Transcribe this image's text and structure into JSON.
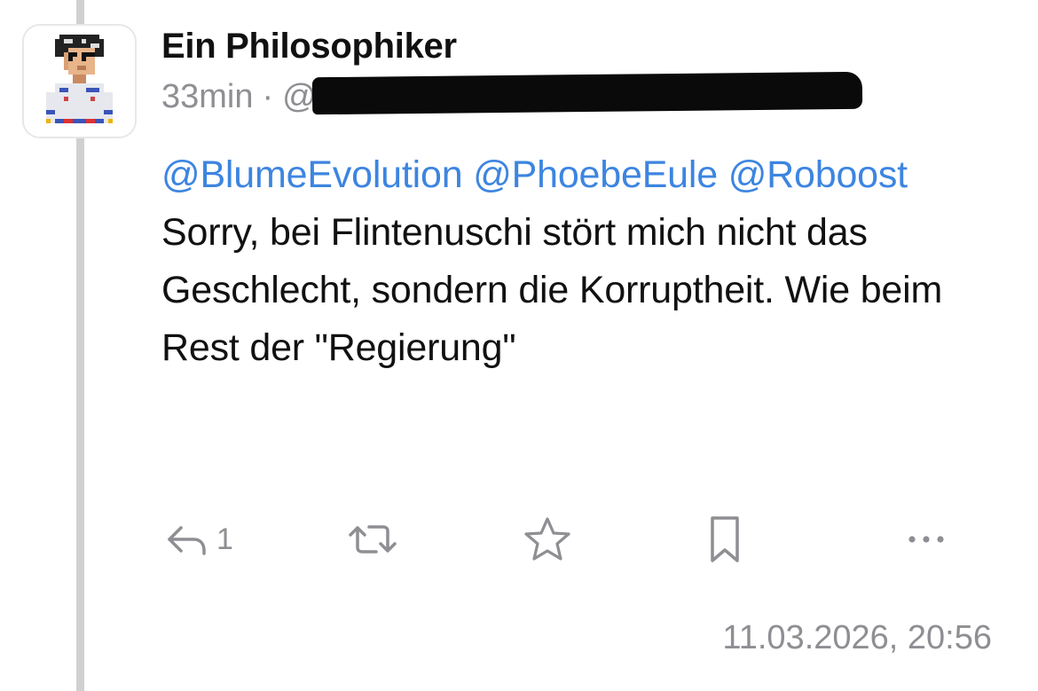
{
  "post": {
    "author_name": "Ein Philosophiker",
    "time_ago": "33min",
    "separator": "·",
    "handle_prefix": "@",
    "mentions": [
      "@BlumeEvolution",
      "@PhoebeEule",
      "@Roboost"
    ],
    "body_text": "Sorry, bei Flintenuschi stört mich nicht das Geschlecht, sondern die Korruptheit. Wie beim Rest der \"Regierung\"",
    "timestamp": "11.03.2026, 20:56"
  },
  "actions": {
    "reply_icon": "reply-icon",
    "reply_count": "1",
    "boost_icon": "repost-icon",
    "favourite_icon": "star-icon",
    "bookmark_icon": "bookmark-icon",
    "more_icon": "more-icon"
  },
  "colors": {
    "mention": "#3d85e0",
    "secondary_text": "#8e8e93",
    "primary_text": "#111111",
    "thread_line": "#cfd0d2"
  }
}
